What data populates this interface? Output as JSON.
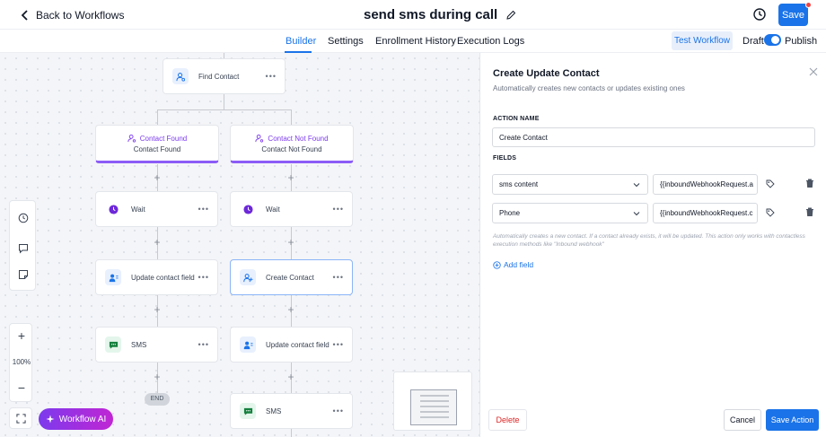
{
  "header": {
    "back_label": "Back to Workflows",
    "workflow_title": "send sms during call",
    "save_label": "Save"
  },
  "tabs": [
    {
      "label": "Builder",
      "active": true
    },
    {
      "label": "Settings",
      "active": false
    },
    {
      "label": "Enrollment History",
      "active": false
    },
    {
      "label": "Execution Logs",
      "active": false
    }
  ],
  "toolbar": {
    "test_workflow_label": "Test Workflow",
    "draft_label": "Draft",
    "publish_label": "Publish",
    "published": true
  },
  "canvas": {
    "trigger_node": {
      "label": "Find Contact",
      "icon": "contact-search-icon"
    },
    "branches": [
      {
        "title": "Contact Found",
        "subtitle": "Contact Found",
        "nodes": [
          {
            "label": "Wait",
            "icon": "clock-icon"
          },
          {
            "label": "Update contact field",
            "icon": "contact-edit-icon"
          },
          {
            "label": "SMS",
            "icon": "sms-icon"
          }
        ],
        "end_label": "END"
      },
      {
        "title": "Contact Not Found",
        "subtitle": "Contact Not Found",
        "nodes": [
          {
            "label": "Wait",
            "icon": "clock-icon"
          },
          {
            "label": "Create Contact",
            "icon": "contact-create-icon",
            "selected": true
          },
          {
            "label": "Update contact field",
            "icon": "contact-edit-icon"
          },
          {
            "label": "SMS",
            "icon": "sms-icon"
          }
        ]
      }
    ],
    "zoom_level": "100%",
    "ai_button_label": "Workflow AI"
  },
  "panel": {
    "title": "Create Update Contact",
    "subtitle": "Automatically creates new contacts or updates existing ones",
    "action_name_label": "ACTION NAME",
    "action_name_value": "Create Contact",
    "fields_label": "FIELDS",
    "fields": [
      {
        "field": "sms content",
        "value": "{{inboundWebhookRequest.a"
      },
      {
        "field": "Phone",
        "value": "{{inboundWebhookRequest.c"
      }
    ],
    "hint": "Automatically creates a new contact. If a contact already exists, it will be updated. This action only works with contactless execution methods like \"Inbound webhook\"",
    "add_field_label": "Add field",
    "delete_label": "Delete",
    "cancel_label": "Cancel",
    "save_action_label": "Save Action"
  },
  "colors": {
    "primary": "#1a73e8",
    "branch_accent": "#8b5cf6",
    "danger": "#dc2626"
  }
}
